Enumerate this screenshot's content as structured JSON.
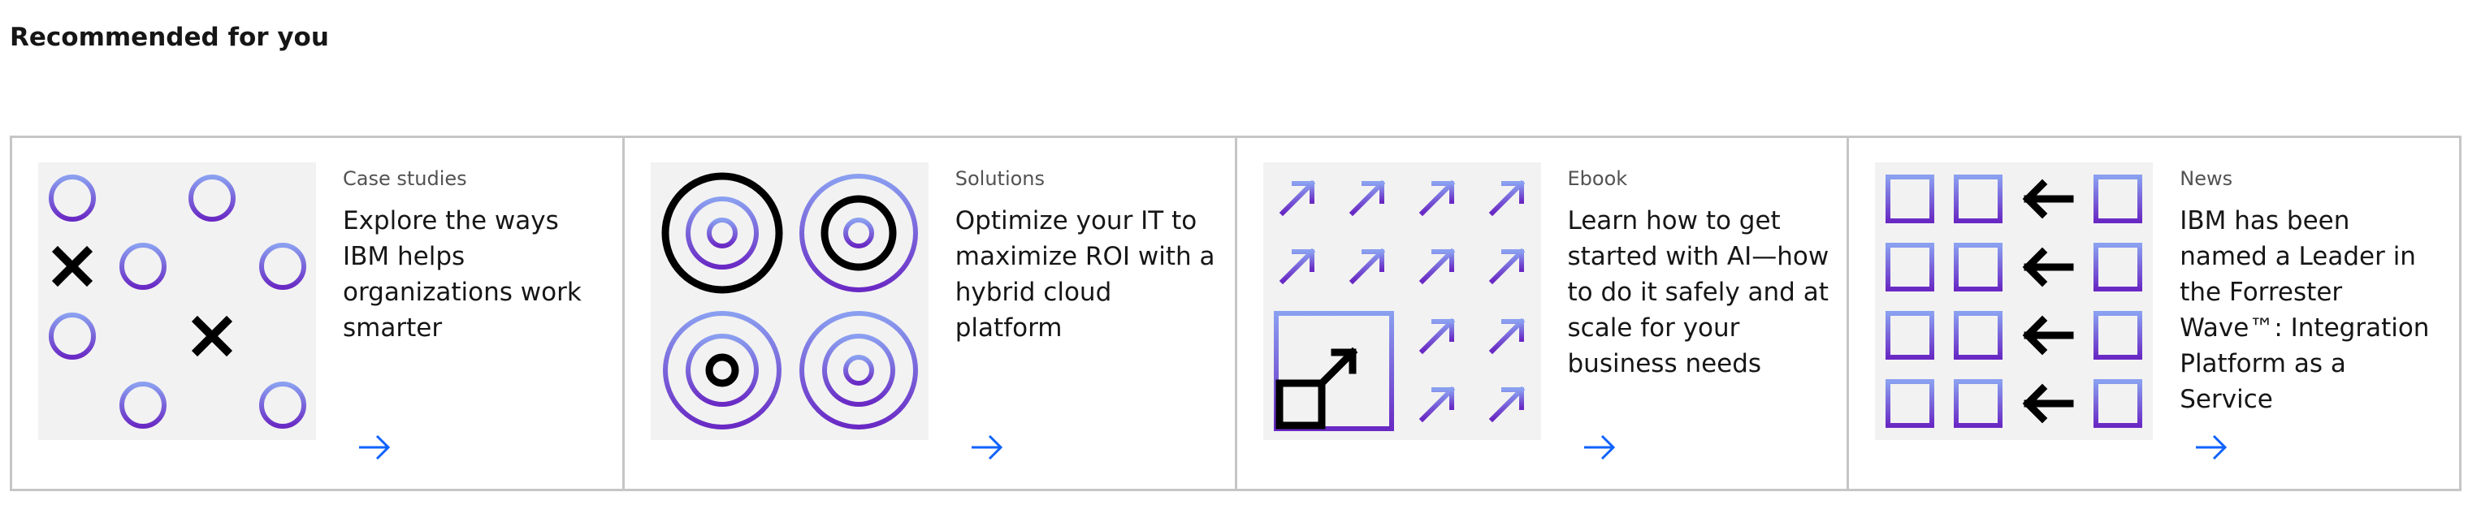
{
  "section": {
    "title": "Recommended for you"
  },
  "colors": {
    "accent": "#0f62fe",
    "pictogram_gradient_top": "#8a9ff0",
    "pictogram_gradient_bottom": "#6929c4",
    "pictogram_bg": "#f2f2f2"
  },
  "cards": [
    {
      "eyebrow": "Case studies",
      "headline": "Explore the ways IBM helps organizations work smarter",
      "icon": "arrow-right-icon"
    },
    {
      "eyebrow": "Solutions",
      "headline": "Optimize your IT to maximize ROI with a hybrid cloud platform",
      "icon": "arrow-right-icon"
    },
    {
      "eyebrow": "Ebook",
      "headline": "Learn how to get started with AI—how to do it safely and at scale for your business needs",
      "icon": "arrow-right-icon"
    },
    {
      "eyebrow": "News",
      "headline": "IBM has been named a Leader in the Forrester Wave™: Integration Platform as a Service",
      "icon": "arrow-right-icon"
    }
  ]
}
